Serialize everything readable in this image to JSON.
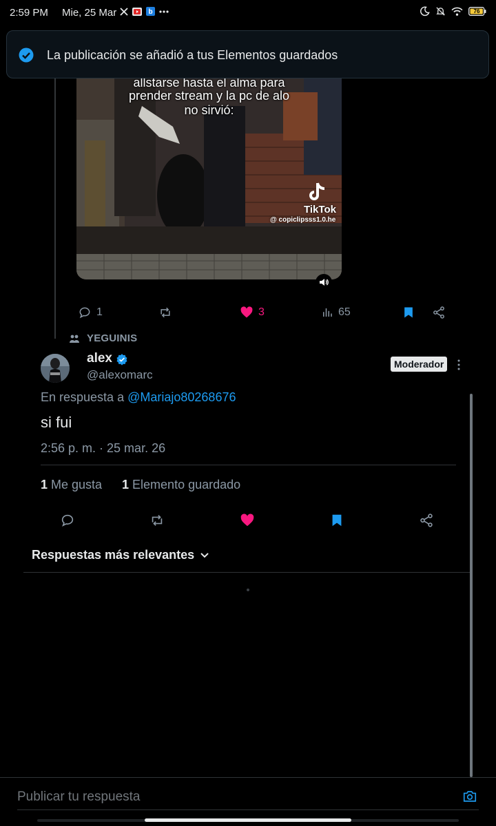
{
  "status_bar": {
    "time": "2:59 PM",
    "date": "Mie, 25 Mar",
    "battery": "76"
  },
  "toast": {
    "text": "La publicación se añadió a tus Elementos guardados"
  },
  "media": {
    "caption_lines": [
      "allstarse hasta el alma para",
      "prender stream y la pc de alo",
      "no sirvió:"
    ],
    "watermark_name": "TikTok",
    "watermark_handle": "@ copiclipsss1.0.he"
  },
  "parent_post_actions": {
    "replies": "1",
    "likes": "3",
    "views": "65"
  },
  "community": {
    "name": "YEGUINIS"
  },
  "post": {
    "author_name": "alex",
    "author_handle": "@alexomarc",
    "badge": "Moderador",
    "reply_prefix": "En respuesta a",
    "reply_handle": "@Mariajo80268676",
    "text": "si fui",
    "timestamp": "2:56 p. m. · 25 mar. 26",
    "likes_count": "1",
    "likes_label": "Me gusta",
    "bookmarks_count": "1",
    "bookmarks_label": "Elemento guardado"
  },
  "replies_sort": {
    "label": "Respuestas más relevantes"
  },
  "composer": {
    "placeholder": "Publicar tu respuesta"
  },
  "colors": {
    "accent": "#1d9bf0",
    "like": "#f91880",
    "text": "#e7e9ea",
    "muted": "#8b98a5",
    "background": "#000000"
  }
}
